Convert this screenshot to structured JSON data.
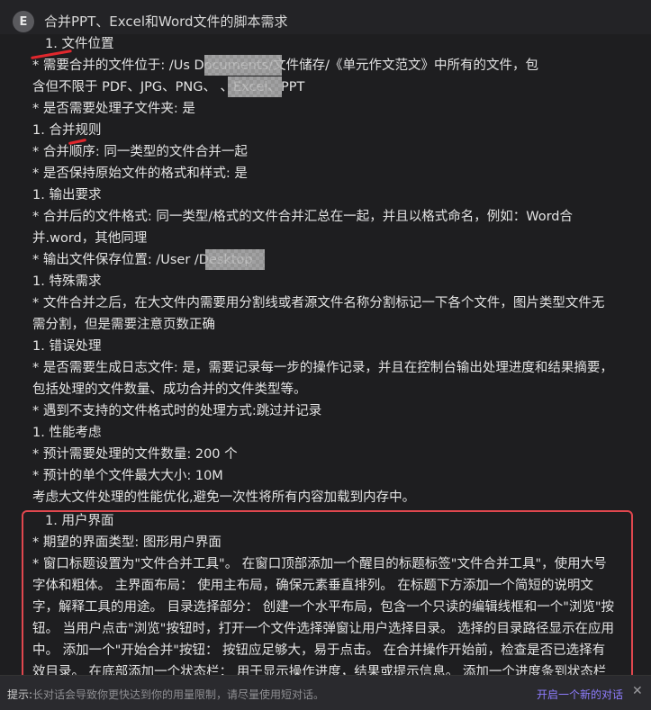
{
  "header": {
    "avatar_letter": "E",
    "title": "合并PPT、Excel和Word文件的脚本需求"
  },
  "lines": [
    "1. 文件位置",
    "* 需要合并的文件位于: /Us                    Documents/文件储存/《单元作文范文》中所有的文件，包",
    "含但不限于 PDF、JPG、PNG、        、Excel、PPT",
    "* 是否需要处理子文件夹: 是",
    "1. 合并规则",
    "* 合并顺序: 同一类型的文件合并一起",
    "* 是否保持原始文件的格式和样式: 是",
    "1. 输出要求",
    "* 合并后的文件格式: 同一类型/格式的文件合并汇总在一起，并且以格式命名，例如：Word合",
    "并.word，其他同理",
    "* 输出文件保存位置: /User             /Desktop",
    "1. 特殊需求",
    "* 文件合并之后，在大文件内需要用分割线或者源文件名称分割标记一下各个文件，图片类型文件无",
    "需分割，但是需要注意页数正确",
    "1. 错误处理",
    "* 是否需要生成日志文件: 是，需要记录每一步的操作记录，并且在控制台输出处理进度和结果摘要，",
    "包括处理的文件数量、成功合并的文件类型等。",
    "* 遇到不支持的文件格式时的处理方式:跳过并记录",
    "1. 性能考虑",
    "* 预计需要处理的文件数量: 200 个",
    "* 预计的单个文件最大大小: 10M",
    "考虑大文件处理的性能优化,避免一次性将所有内容加载到内存中。",
    "1. 用户界面",
    "* 期望的界面类型: 图形用户界面",
    "* 窗口标题设置为\"文件合并工具\"。 在窗口顶部添加一个醒目的标题标签\"文件合并工具\"，使用大号",
    "字体和粗体。 主界面布局： 使用主布局，确保元素垂直排列。 在标题下方添加一个简短的说明文",
    "字，解释工具的用途。 目录选择部分： 创建一个水平布局，包含一个只读的编辑线框和一个\"浏览\"按",
    "钮。 当用户点击\"浏览\"按钮时，打开一个文件选择弹窗让用户选择目录。 选择的目录路径显示在应用",
    "中。 添加一个\"开始合并\"按钮： 按钮应足够大，易于点击。 在合并操作开始前，检查是否已选择有",
    "效目录。 在底部添加一个状态栏： 用于显示操作进度，结果或提示信息。 添加一个进度条到状态栏"
  ],
  "footer": {
    "hint_label": "提示:",
    "hint_text": "长对话会导致你更快达到你的用量限制，请尽量使用短对话。",
    "new_chat": "开启一个新的对话",
    "close": "✕"
  },
  "colors": {
    "background": "#1e1e20",
    "accent": "#8f7dff",
    "highlight": "#e0474e"
  }
}
